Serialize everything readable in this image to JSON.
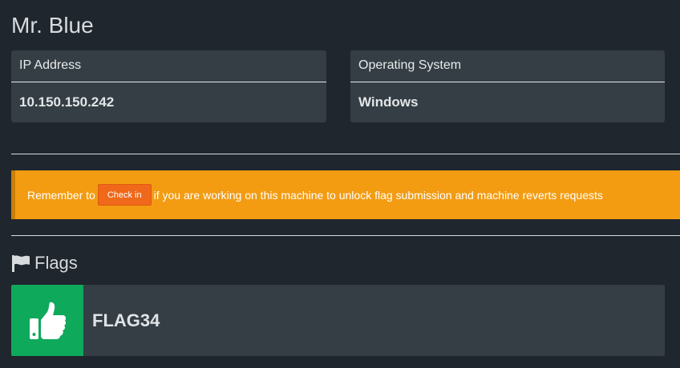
{
  "machine": {
    "name": "Mr. Blue"
  },
  "info_cards": {
    "ip": {
      "label": "IP Address",
      "value": "10.150.150.242"
    },
    "os": {
      "label": "Operating System",
      "value": "Windows"
    }
  },
  "alert": {
    "prefix": "Remember to",
    "button_label": "Check in",
    "suffix": "if you are working on this machine to unlock flag submission and machine reverts requests"
  },
  "flags": {
    "heading": "Flags",
    "heading_icon": "flag-icon",
    "items": [
      {
        "name": "FLAG34",
        "status_icon": "thumbs-up-icon",
        "status_color": "#0ea95b"
      }
    ]
  },
  "colors": {
    "background": "#20262d",
    "card": "#343e44",
    "alert": "#f39c12",
    "checkin_button": "#f0681a",
    "flag_success": "#0ea95b"
  }
}
